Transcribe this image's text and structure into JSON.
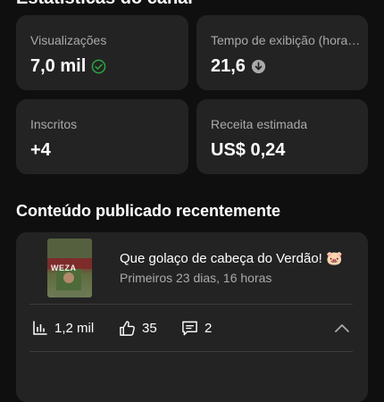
{
  "section_channel_title": "Estatísticas do canal",
  "stats": [
    {
      "label": "Visualizações",
      "value": "7,0 mil",
      "icon": "check-circle-icon",
      "icon_color": "#2ba640"
    },
    {
      "label": "Tempo de exibição (hora…",
      "value": "21,6",
      "icon": "arrow-down-circle-icon",
      "icon_color": "#aaaaaa"
    },
    {
      "label": "Inscritos",
      "value": "+4"
    },
    {
      "label": "Receita estimada",
      "value": "US$ 0,24"
    }
  ],
  "recent": {
    "title": "Conteúdo publicado recentemente",
    "video": {
      "title": "Que golaço de cabeça do Verdão! 🐷",
      "subtitle": "Primeiros 23 dias, 16 horas",
      "thumbnail_text": "WEZA"
    },
    "metrics": {
      "views": "1,2 mil",
      "likes": "35",
      "comments": "2"
    }
  },
  "colors": {
    "background": "#0f0f0f",
    "card": "#232323",
    "muted_text": "#aaaaaa",
    "success": "#2ba640"
  }
}
